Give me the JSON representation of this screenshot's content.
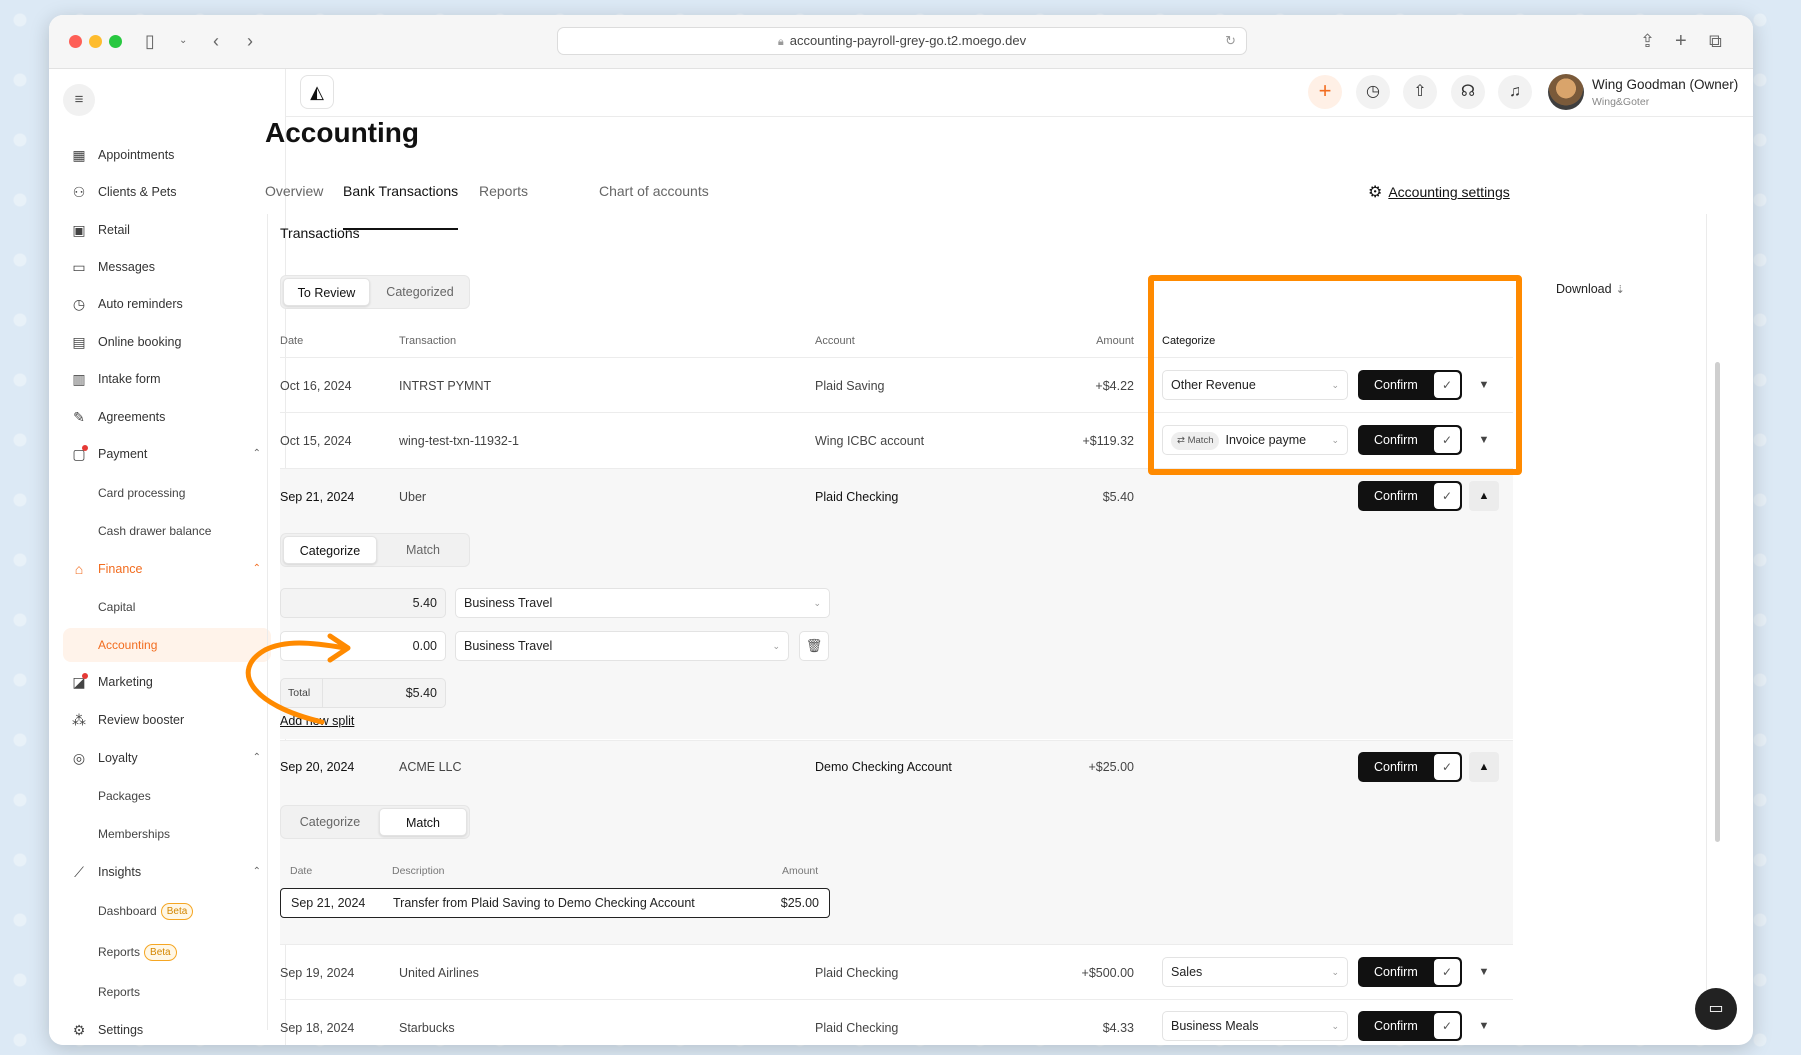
{
  "browser": {
    "url": "accounting-payroll-grey-go.t2.moego.dev"
  },
  "sidebar": {
    "items": [
      {
        "label": "Appointments",
        "icon": "calendar-icon"
      },
      {
        "label": "Clients & Pets",
        "icon": "user-icon"
      },
      {
        "label": "Retail",
        "icon": "bag-icon"
      },
      {
        "label": "Messages",
        "icon": "message-icon"
      },
      {
        "label": "Auto reminders",
        "icon": "alarm-icon"
      },
      {
        "label": "Online booking",
        "icon": "booking-icon"
      },
      {
        "label": "Intake form",
        "icon": "form-icon"
      },
      {
        "label": "Agreements",
        "icon": "pen-icon"
      },
      {
        "label": "Payment",
        "icon": "payment-icon"
      },
      {
        "label": "Card processing"
      },
      {
        "label": "Cash drawer balance"
      },
      {
        "label": "Finance",
        "icon": "finance-icon"
      },
      {
        "label": "Capital"
      },
      {
        "label": "Accounting"
      },
      {
        "label": "Marketing",
        "icon": "megaphone-icon"
      },
      {
        "label": "Review booster",
        "icon": "review-icon"
      },
      {
        "label": "Loyalty",
        "icon": "loyalty-icon"
      },
      {
        "label": "Packages"
      },
      {
        "label": "Memberships"
      },
      {
        "label": "Insights",
        "icon": "chart-icon"
      },
      {
        "label": "Dashboard",
        "badge": "Beta"
      },
      {
        "label": "Reports",
        "badge": "Beta"
      },
      {
        "label": "Reports"
      },
      {
        "label": "Settings",
        "icon": "gear-icon"
      }
    ]
  },
  "header": {
    "user_name": "Wing Goodman (Owner)",
    "business": "Wing&Goter"
  },
  "page": {
    "title": "Accounting",
    "tabs": [
      "Overview",
      "Bank Transactions",
      "Reports",
      "Chart of accounts"
    ],
    "settings_link": "Accounting settings"
  },
  "transactions": {
    "title": "Transactions",
    "filters": [
      "To Review",
      "Categorized"
    ],
    "download": "Download",
    "columns": [
      "Date",
      "Transaction",
      "Account",
      "Amount",
      "Categorize"
    ],
    "confirm_label": "Confirm",
    "rows": [
      {
        "date": "Oct 16, 2024",
        "transaction": "INTRST PYMNT",
        "account": "Plaid Saving",
        "amount": "+$4.22",
        "category": "Other Revenue"
      },
      {
        "date": "Oct 15, 2024",
        "transaction": "wing-test-txn-11932-1",
        "account": "Wing ICBC account",
        "amount": "+$119.32",
        "match_badge": "Match",
        "category": "Invoice payme"
      },
      {
        "date": "Sep 21, 2024",
        "transaction": "Uber",
        "account": "Plaid Checking",
        "amount": "$5.40"
      },
      {
        "date": "Sep 20, 2024",
        "transaction": "ACME LLC",
        "account": "Demo Checking Account",
        "amount": "+$25.00"
      },
      {
        "date": "Sep 19, 2024",
        "transaction": "United Airlines",
        "account": "Plaid Checking",
        "amount": "+$500.00",
        "category": "Sales"
      },
      {
        "date": "Sep 18, 2024",
        "transaction": "Starbucks",
        "account": "Plaid Checking",
        "amount": "$4.33",
        "category": "Business Meals"
      }
    ],
    "split_panel": {
      "toggle": [
        "Categorize",
        "Match"
      ],
      "splits": [
        {
          "amount": "5.40",
          "category": "Business Travel"
        },
        {
          "amount": "0.00",
          "category": "Business Travel"
        }
      ],
      "total_label": "Total",
      "total_value": "$5.40",
      "add_split": "Add new split"
    },
    "match_panel": {
      "toggle": [
        "Categorize",
        "Match"
      ],
      "columns": [
        "Date",
        "Description",
        "Amount"
      ],
      "row": {
        "date": "Sep 21, 2024",
        "description": "Transfer from Plaid Saving to Demo Checking Account",
        "amount": "$25.00"
      }
    }
  },
  "colors": {
    "accent": "#f26c1f",
    "highlight": "#ff8a00",
    "confirm_bg": "#111111"
  }
}
